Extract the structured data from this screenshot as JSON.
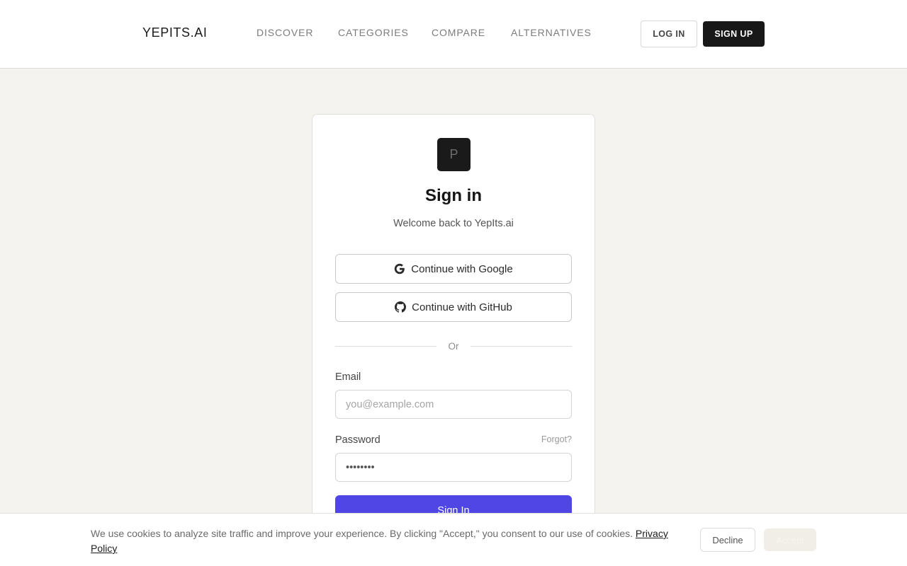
{
  "header": {
    "logo": "YEPITS.AI",
    "nav": [
      "DISCOVER",
      "CATEGORIES",
      "COMPARE",
      "ALTERNATIVES"
    ],
    "login_label": "LOG IN",
    "signup_label": "SIGN UP"
  },
  "signin": {
    "app_icon_letter": "P",
    "title": "Sign in",
    "subtitle": "Welcome back to YepIts.ai",
    "google_label": "Continue with Google",
    "github_label": "Continue with GitHub",
    "divider_text": "Or",
    "email_label": "Email",
    "email_placeholder": "you@example.com",
    "password_label": "Password",
    "forgot_label": "Forgot?",
    "password_value": "••••••••",
    "submit_label": "Sign In"
  },
  "cookie_banner": {
    "text": "We use cookies to analyze site traffic and improve your experience. By clicking \"Accept,\" you consent to our use of cookies.",
    "link_label": "Privacy Policy",
    "decline_label": "Decline",
    "accept_label": "Accept"
  },
  "colors": {
    "page_background": "#f4f3ef",
    "primary": "#4f46e5",
    "dark": "#181818"
  },
  "icons": {
    "google": "google-icon",
    "github": "github-icon"
  }
}
